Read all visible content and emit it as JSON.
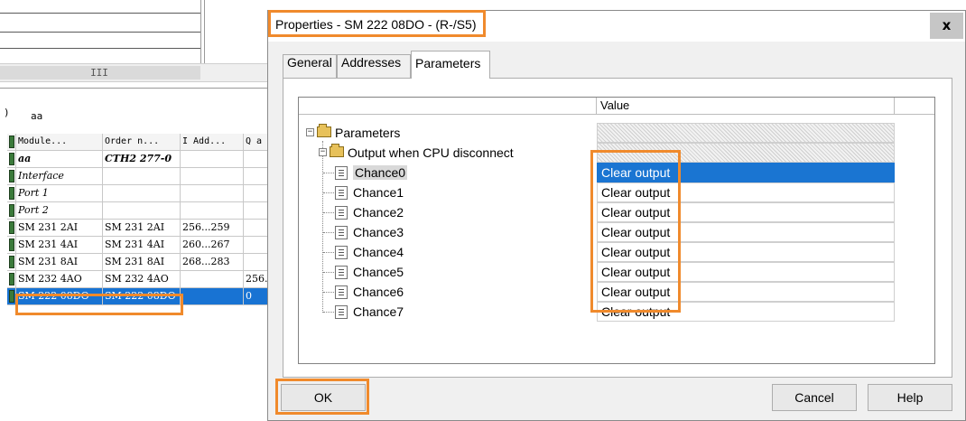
{
  "background": {
    "scroll_glyph": "III",
    "station_paren": ")",
    "station_name": "aa",
    "table": {
      "headers": [
        "Module...",
        "Order n...",
        "I Add...",
        "Q a"
      ],
      "rows": [
        {
          "module": "aa",
          "order": "CTH2 277-0",
          "i_addr": "",
          "q_addr": "",
          "style": "bold"
        },
        {
          "module": "Interface",
          "order": "",
          "i_addr": "",
          "q_addr": "",
          "style": "italic"
        },
        {
          "module": "Port 1",
          "order": "",
          "i_addr": "",
          "q_addr": "",
          "style": "italic"
        },
        {
          "module": "Port 2",
          "order": "",
          "i_addr": "",
          "q_addr": "",
          "style": "italic"
        },
        {
          "module": "SM 231 2AI",
          "order": "SM 231 2AI",
          "i_addr": "256...259",
          "q_addr": "",
          "style": "normal"
        },
        {
          "module": "SM 231 4AI",
          "order": "SM 231 4AI",
          "i_addr": "260...267",
          "q_addr": "",
          "style": "normal"
        },
        {
          "module": "SM 231 8AI",
          "order": "SM 231 8AI",
          "i_addr": "268...283",
          "q_addr": "",
          "style": "normal"
        },
        {
          "module": "SM 232 4AO",
          "order": "SM 232 4AO",
          "i_addr": "",
          "q_addr": "256.",
          "style": "normal"
        },
        {
          "module": "SM 222 08DO",
          "order": "SM 222 08DO",
          "i_addr": "",
          "q_addr": "0",
          "style": "selected"
        }
      ]
    }
  },
  "dialog": {
    "title": "Properties - SM 222 08DO - (R-/S5)",
    "close_label": "x",
    "tabs": [
      {
        "label": "General",
        "active": false
      },
      {
        "label": "Addresses",
        "active": false
      },
      {
        "label": "Parameters",
        "active": true
      }
    ],
    "grid": {
      "value_header": "Value",
      "root_label": "Parameters",
      "group_label": "Output when CPU disconnect",
      "channels": [
        {
          "label": "Chance0",
          "value": "Clear output",
          "selected": true
        },
        {
          "label": "Chance1",
          "value": "Clear output",
          "selected": false
        },
        {
          "label": "Chance2",
          "value": "Clear output",
          "selected": false
        },
        {
          "label": "Chance3",
          "value": "Clear output",
          "selected": false
        },
        {
          "label": "Chance4",
          "value": "Clear output",
          "selected": false
        },
        {
          "label": "Chance5",
          "value": "Clear output",
          "selected": false
        },
        {
          "label": "Chance6",
          "value": "Clear output",
          "selected": false
        },
        {
          "label": "Chance7",
          "value": "Clear output",
          "selected": false
        }
      ]
    },
    "buttons": {
      "ok": "OK",
      "cancel": "Cancel",
      "help": "Help"
    }
  },
  "colors": {
    "highlight_orange": "#f08a2c",
    "selection_blue": "#1a75d2"
  }
}
